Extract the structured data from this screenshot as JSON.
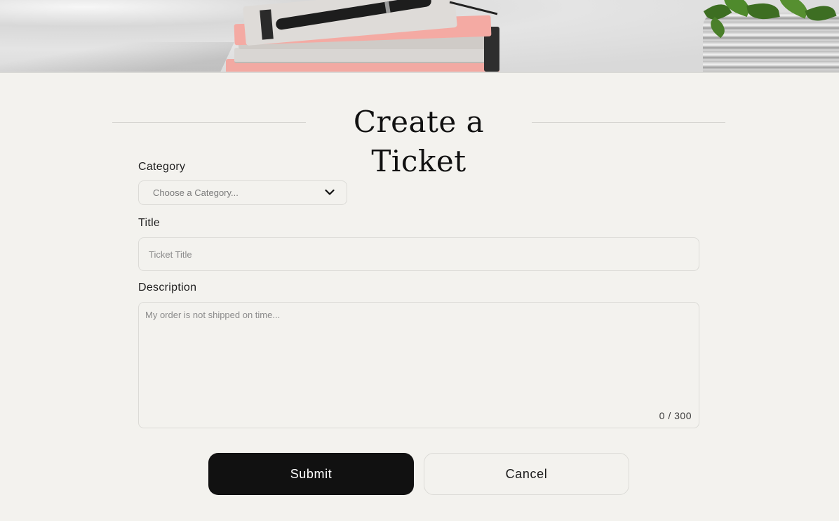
{
  "hero": {
    "image": "desk-with-notebooks-and-plant"
  },
  "page": {
    "title": "Create a Ticket"
  },
  "form": {
    "category": {
      "label": "Category",
      "placeholder": "Choose a Category...",
      "icon": "chevron-down-icon"
    },
    "title": {
      "label": "Title",
      "placeholder": "Ticket Title",
      "value": ""
    },
    "description": {
      "label": "Description",
      "placeholder": "My order is not shipped on time...",
      "value": "",
      "counter": "0 / 300"
    }
  },
  "actions": {
    "submit_label": "Submit",
    "cancel_label": "Cancel"
  },
  "colors": {
    "background": "#f3f2ee",
    "primary_button": "#111111",
    "border": "#dcdbd7"
  }
}
